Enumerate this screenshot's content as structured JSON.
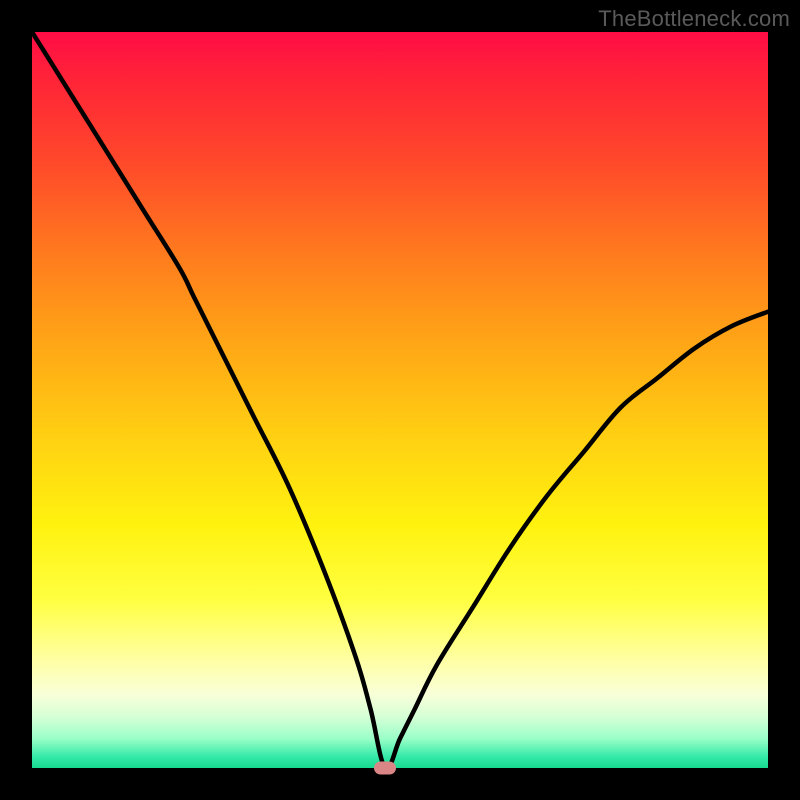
{
  "watermark": "TheBottleneck.com",
  "chart_data": {
    "type": "line",
    "title": "",
    "xlabel": "",
    "ylabel": "",
    "xlim": [
      0,
      100
    ],
    "ylim": [
      0,
      100
    ],
    "grid": false,
    "legend": false,
    "min_marker": {
      "x": 48,
      "y": 0
    },
    "series": [
      {
        "name": "bottleneck-curve",
        "x": [
          0,
          5,
          10,
          15,
          20,
          22,
          25,
          30,
          35,
          40,
          44,
          46,
          48,
          50,
          52,
          55,
          60,
          65,
          70,
          75,
          80,
          85,
          90,
          95,
          100
        ],
        "y": [
          100,
          92,
          84,
          76,
          68,
          64,
          58,
          48,
          38,
          26,
          15,
          8,
          0,
          4,
          8,
          14,
          22,
          30,
          37,
          43,
          49,
          53,
          57,
          60,
          62
        ]
      }
    ],
    "background_gradient_stops": [
      {
        "pos": 0,
        "color": "#ff0d46"
      },
      {
        "pos": 0.06,
        "color": "#ff2238"
      },
      {
        "pos": 0.18,
        "color": "#ff4a2a"
      },
      {
        "pos": 0.3,
        "color": "#ff7a1e"
      },
      {
        "pos": 0.42,
        "color": "#ffa516"
      },
      {
        "pos": 0.55,
        "color": "#ffd012"
      },
      {
        "pos": 0.67,
        "color": "#fff20f"
      },
      {
        "pos": 0.77,
        "color": "#ffff40"
      },
      {
        "pos": 0.85,
        "color": "#ffffa0"
      },
      {
        "pos": 0.9,
        "color": "#f8ffd8"
      },
      {
        "pos": 0.93,
        "color": "#d6ffd6"
      },
      {
        "pos": 0.96,
        "color": "#9affc8"
      },
      {
        "pos": 0.985,
        "color": "#33e9a8"
      },
      {
        "pos": 1.0,
        "color": "#17d98f"
      }
    ]
  }
}
